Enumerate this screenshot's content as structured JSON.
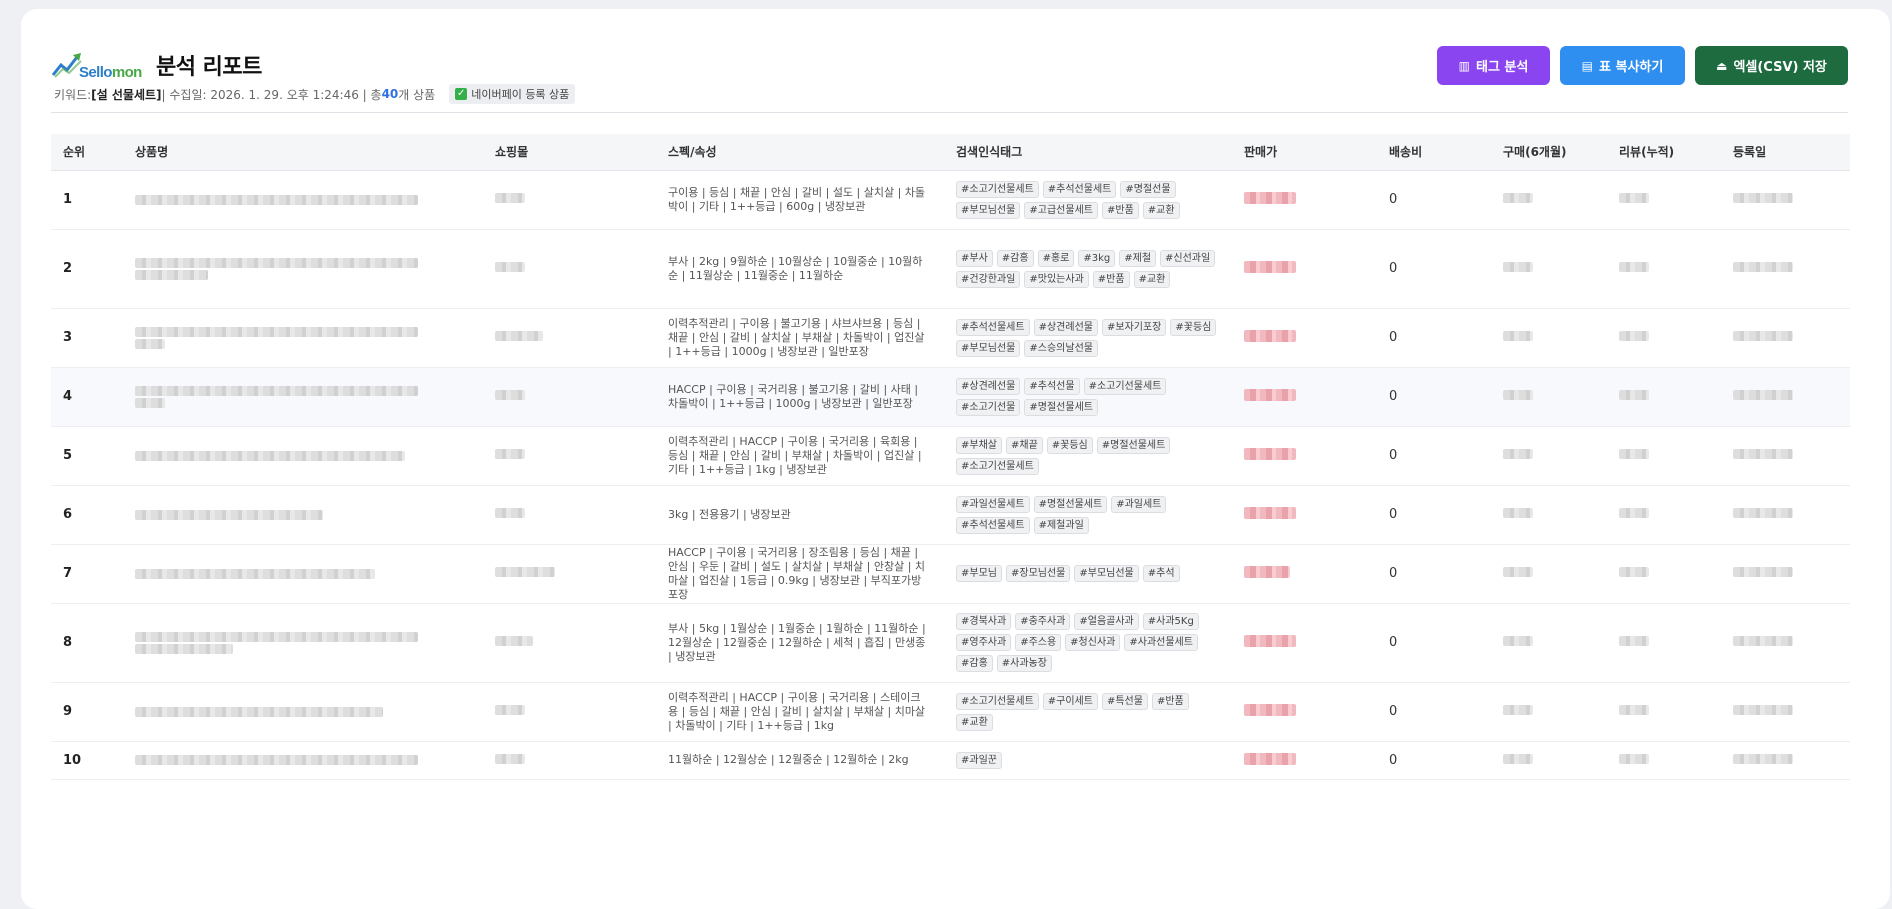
{
  "header": {
    "logo_text_a": "Sello",
    "logo_text_b": "mon",
    "title": "분석 리포트",
    "meta_keyword_label": "키워드: ",
    "meta_keyword": "[설 선물세트]",
    "meta_collected": " | 수집일: 2026. 1. 29. 오후 1:24:46 | 총 ",
    "meta_count": "40",
    "meta_count_suffix": "개 상품",
    "badge_label": "네이버페이 등록 상품"
  },
  "buttons": {
    "tag_analysis": "태그 분석",
    "copy_table": "표 복사하기",
    "excel_save": "엑셀(CSV) 저장"
  },
  "columns": [
    "순위",
    "상품명",
    "쇼핑몰",
    "스펙/속성",
    "검색인식태그",
    "판매가",
    "배송비",
    "구매(6개월)",
    "리뷰(누적)",
    "등록일"
  ],
  "rows": [
    {
      "rank": "1",
      "spec": "구이용 | 등심 | 채끝 | 안심 | 갈비 | 설도 | 살치살 | 차돌박이 | 기타 | 1++등급 | 600g | 냉장보관",
      "tags": [
        "#소고기선물세트",
        "#추석선물세트",
        "#명절선물",
        "#부모님선물",
        "#고급선물세트",
        "#반품",
        "#교환"
      ],
      "shipping": "0"
    },
    {
      "rank": "2",
      "spec": "부사 | 2kg | 9월하순 | 10월상순 | 10월중순 | 10월하순 | 11월상순 | 11월중순 | 11월하순",
      "tags": [
        "#부사",
        "#감홍",
        "#홍로",
        "#3kg",
        "#제철",
        "#신선과일",
        "#건강한과일",
        "#맛있는사과",
        "#반품",
        "#교환"
      ],
      "shipping": "0"
    },
    {
      "rank": "3",
      "spec": "이력추적관리 | 구이용 | 불고기용 | 샤브샤브용 | 등심 | 채끝 | 안심 | 갈비 | 살치살 | 부채살 | 차돌박이 | 업진살 | 1++등급 | 1000g | 냉장보관 | 일반포장",
      "tags": [
        "#추석선물세트",
        "#상견례선물",
        "#보자기포장",
        "#꽃등심",
        "#부모님선물",
        "#스승의날선물"
      ],
      "shipping": "0"
    },
    {
      "rank": "4",
      "spec": "HACCP | 구이용 | 국거리용 | 불고기용 | 갈비 | 사태 | 차돌박이 | 1++등급 | 1000g | 냉장보관 | 일반포장",
      "tags": [
        "#상견례선물",
        "#추석선물",
        "#소고기선물세트",
        "#소고기선물",
        "#명절선물세트"
      ],
      "shipping": "0"
    },
    {
      "rank": "5",
      "spec": "이력추적관리 | HACCP | 구이용 | 국거리용 | 육회용 | 등심 | 채끝 | 안심 | 갈비 | 부채살 | 차돌박이 | 업진살 | 기타 | 1++등급 | 1kg | 냉장보관",
      "tags": [
        "#부채살",
        "#채끝",
        "#꽃등심",
        "#명절선물세트",
        "#소고기선물세트"
      ],
      "shipping": "0"
    },
    {
      "rank": "6",
      "spec": "3kg | 전용용기 | 냉장보관",
      "tags": [
        "#과일선물세트",
        "#명절선물세트",
        "#과일세트",
        "#추석선물세트",
        "#제철과일"
      ],
      "shipping": "0"
    },
    {
      "rank": "7",
      "spec": "HACCP | 구이용 | 국거리용 | 장조림용 | 등심 | 채끝 | 안심 | 우둔 | 갈비 | 설도 | 살치살 | 부채살 | 안창살 | 치마살 | 업진살 | 1등급 | 0.9kg | 냉장보관 | 부직포가방포장",
      "tags": [
        "#부모님",
        "#장모님선물",
        "#부모님선물",
        "#추석"
      ],
      "shipping": "0"
    },
    {
      "rank": "8",
      "spec": "부사 | 5kg | 1월상순 | 1월중순 | 1월하순 | 11월하순 | 12월상순 | 12월중순 | 12월하순 | 세척 | 흡집 | 만생종 | 냉장보관",
      "tags": [
        "#경북사과",
        "#충주사과",
        "#얼음골사과",
        "#사과5Kg",
        "#영주사과",
        "#주스용",
        "#청신사과",
        "#사과선물세트",
        "#감홍",
        "#사과농장"
      ],
      "shipping": "0"
    },
    {
      "rank": "9",
      "spec": "이력추적관리 | HACCP | 구이용 | 국거리용 | 스테이크용 | 등심 | 채끝 | 안심 | 갈비 | 살치살 | 부채살 | 치마살 | 차돌박이 | 기타 | 1++등급 | 1kg",
      "tags": [
        "#소고기선물세트",
        "#구이세트",
        "#특선물",
        "#반품",
        "#교환"
      ],
      "shipping": "0"
    },
    {
      "rank": "10",
      "spec": "11월하순 | 12월상순 | 12월중순 | 12월하순 | 2kg",
      "tags": [
        "#과일꾼"
      ],
      "shipping": "0"
    }
  ]
}
